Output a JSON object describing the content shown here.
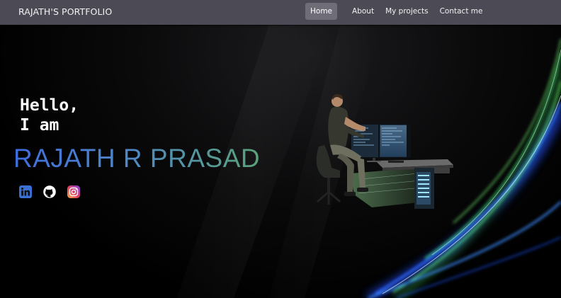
{
  "brand": "RAJATH'S PORTFOLIO",
  "nav": {
    "items": [
      {
        "label": "Home",
        "active": true
      },
      {
        "label": "About",
        "active": false
      },
      {
        "label": "My projects",
        "active": false
      },
      {
        "label": "Contact me",
        "active": false
      }
    ]
  },
  "hero": {
    "greeting_line1": "Hello,",
    "greeting_line2": "I am",
    "name": "RAJATH R PRASAD",
    "socials": [
      {
        "icon": "linkedin-icon"
      },
      {
        "icon": "github-icon"
      },
      {
        "icon": "instagram-icon"
      }
    ],
    "illustration": "person-at-computer-desk"
  },
  "colors": {
    "navbar": "#4b4a55",
    "nav_active": "#6f6e78",
    "name_gradient_start": "#3f6cdf",
    "name_gradient_end": "#5aa37a",
    "background": "#000000"
  }
}
